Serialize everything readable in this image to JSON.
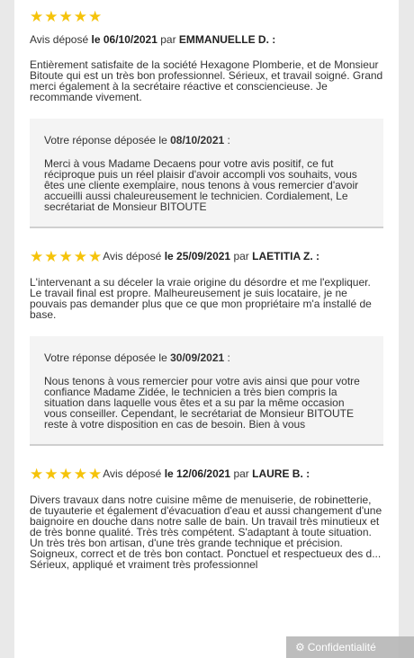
{
  "reviews": [
    {
      "stars": "★★★★★",
      "meta_prefix": "Avis déposé ",
      "date": "le 06/10/2021",
      "by": " par ",
      "author": "EMMANUELLE D. :",
      "text": "Entièrement satisfaite de la société Hexagone Plomberie, et de Monsieur Bitoute qui est un très bon professionnel. Sérieux, et travail soigné. Grand merci également à la secrétaire réactive et consciencieuse. Je recommande vivement.",
      "reply_prefix": "Votre réponse déposée le ",
      "reply_date": "08/10/2021",
      "reply_suffix": " :",
      "reply_text": "Merci à vous Madame Decaens pour votre avis positif, ce fut réciproque puis un réel plaisir d'avoir accompli vos souhaits, vous êtes une cliente exemplaire, nous tenons à vous remercier d'avoir accueilli aussi chaleureusement le technicien. Cordialement, Le secrétariat de Monsieur BITOUTE"
    },
    {
      "stars": "★★★★★",
      "meta_prefix": "Avis déposé ",
      "date": "le 25/09/2021",
      "by": " par ",
      "author": "LAETITIA Z. :",
      "text": "L'intervenant a su déceler la vraie origine du désordre et me l'expliquer. Le travail final est propre. Malheureusement je suis locataire, je ne pouvais pas demander plus que ce que mon propriétaire m'a installé de base.",
      "reply_prefix": "Votre réponse déposée le ",
      "reply_date": "30/09/2021",
      "reply_suffix": " :",
      "reply_text": "Nous tenons à vous remercier pour votre avis ainsi que pour votre confiance Madame Zidée, le technicien a très bien compris la situation dans laquelle vous êtes et a su par la même occasion vous conseiller. Cependant, le secrétariat de Monsieur BITOUTE reste à votre disposition en cas de besoin. Bien à vous"
    },
    {
      "stars": "★★★★★",
      "meta_prefix": "Avis déposé ",
      "date": "le 12/06/2021",
      "by": " par ",
      "author": "LAURE B. :",
      "text": "Divers travaux dans notre cuisine même de menuiserie, de robinetterie, de tuyauterie et également d'évacuation d'eau et aussi changement d'une baignoire en douche dans notre salle de bain. Un travail très minutieux et de très bonne qualité. Très très compétent. S'adaptant à toute situation. Un très très bon artisan, d'une très grande technique et précision. Soigneux, correct et de très bon contact. Ponctuel et respectueux des d... Sérieux, appliqué et vraiment très professionnel"
    }
  ],
  "confidentiality": {
    "icon": "gear-icon",
    "label": "Confidentialité"
  },
  "colors": {
    "star": "#f5c30a",
    "reply_bg": "#f4f4f4",
    "badge_bg": "#b8b8b8"
  }
}
